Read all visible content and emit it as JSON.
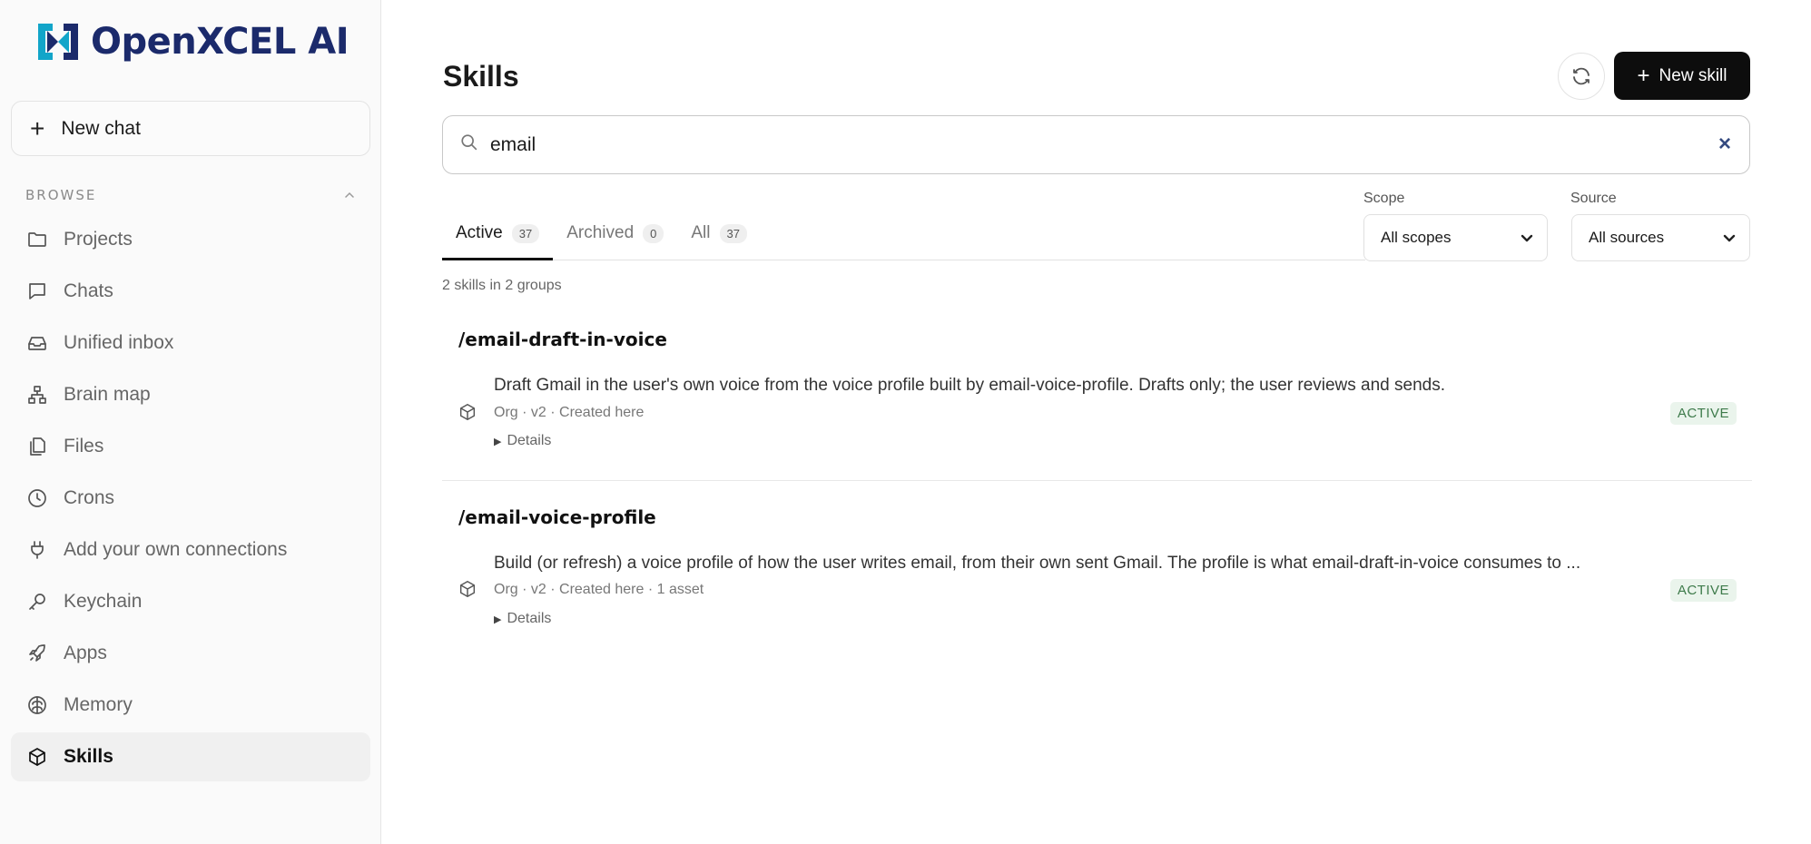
{
  "brand": {
    "name": "OpenXCEL AI",
    "color": "#1b2a6b",
    "accent": "#12a5c9"
  },
  "sidebar": {
    "new_chat_label": "New chat",
    "browse_label": "BROWSE",
    "items": [
      {
        "label": "Projects",
        "icon": "folder-icon"
      },
      {
        "label": "Chats",
        "icon": "chat-bubble-icon"
      },
      {
        "label": "Unified inbox",
        "icon": "inbox-icon"
      },
      {
        "label": "Brain map",
        "icon": "hierarchy-icon"
      },
      {
        "label": "Files",
        "icon": "files-icon"
      },
      {
        "label": "Crons",
        "icon": "clock-icon"
      },
      {
        "label": "Add your own connections",
        "icon": "plug-icon"
      },
      {
        "label": "Keychain",
        "icon": "key-icon"
      },
      {
        "label": "Apps",
        "icon": "rocket-icon"
      },
      {
        "label": "Memory",
        "icon": "brain-icon"
      },
      {
        "label": "Skills",
        "icon": "cube-icon",
        "active": true
      }
    ]
  },
  "header": {
    "title": "Skills",
    "new_skill_label": "New skill"
  },
  "search": {
    "value": "email",
    "clear_label": "×"
  },
  "tabs": [
    {
      "label": "Active",
      "count": "37",
      "active": true
    },
    {
      "label": "Archived",
      "count": "0"
    },
    {
      "label": "All",
      "count": "37"
    }
  ],
  "filters": {
    "scope": {
      "label": "Scope",
      "value": "All scopes"
    },
    "source": {
      "label": "Source",
      "value": "All sources"
    }
  },
  "summary": "2 skills in 2 groups",
  "skills": [
    {
      "name": "/email-draft-in-voice",
      "description": "Draft Gmail in the user's own voice from the voice profile built by email-voice-profile. Drafts only; the user reviews and sends.",
      "meta": "Org · v2 · Created here",
      "details_label": "Details",
      "status": "ACTIVE"
    },
    {
      "name": "/email-voice-profile",
      "description": "Build (or refresh) a voice profile of how the user writes email, from their own sent Gmail. The profile is what email-draft-in-voice consumes to ...",
      "meta": "Org · v2 · Created here · 1 asset",
      "details_label": "Details",
      "status": "ACTIVE"
    }
  ]
}
